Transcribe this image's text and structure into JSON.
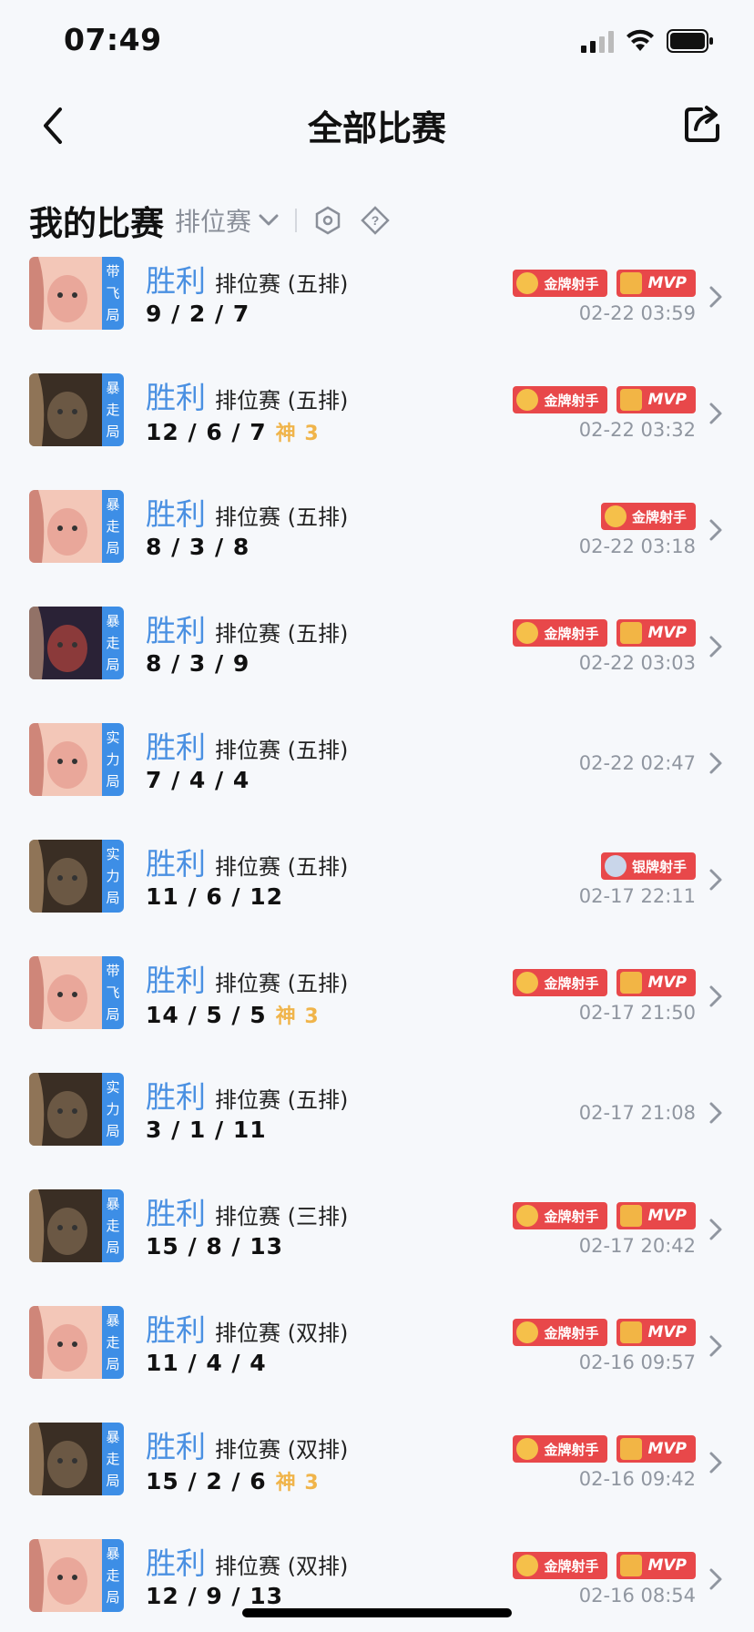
{
  "status_bar": {
    "time": "07:49"
  },
  "nav": {
    "title": "全部比赛"
  },
  "section": {
    "title": "我的比赛",
    "filter_label": "排位赛"
  },
  "colors": {
    "accent_blue": "#4a90e2",
    "tag_blue": "#3d8ee6",
    "badge_red": "#e8484a",
    "streak_gold": "#f0b44a"
  },
  "matches": [
    {
      "hero": "pink",
      "tag": "带飞局",
      "result": "胜利",
      "type": "排位赛 (五排)",
      "kda": "9 / 2 / 7",
      "streak": "",
      "badges": [
        "金牌射手",
        "MVP"
      ],
      "time": "02-22 03:59"
    },
    {
      "hero": "hat",
      "tag": "暴走局",
      "result": "胜利",
      "type": "排位赛 (五排)",
      "kda": "12 / 6 / 7",
      "streak": "神 3",
      "badges": [
        "金牌射手",
        "MVP"
      ],
      "time": "02-22 03:32"
    },
    {
      "hero": "pink",
      "tag": "暴走局",
      "result": "胜利",
      "type": "排位赛 (五排)",
      "kda": "8 / 3 / 8",
      "streak": "",
      "badges": [
        "金牌射手"
      ],
      "time": "02-22 03:18"
    },
    {
      "hero": "dark",
      "tag": "暴走局",
      "result": "胜利",
      "type": "排位赛 (五排)",
      "kda": "8 / 3 / 9",
      "streak": "",
      "badges": [
        "金牌射手",
        "MVP"
      ],
      "time": "02-22 03:03"
    },
    {
      "hero": "pink",
      "tag": "实力局",
      "result": "胜利",
      "type": "排位赛 (五排)",
      "kda": "7 / 4 / 4",
      "streak": "",
      "badges": [],
      "time": "02-22 02:47"
    },
    {
      "hero": "hat",
      "tag": "实力局",
      "result": "胜利",
      "type": "排位赛 (五排)",
      "kda": "11 / 6 / 12",
      "streak": "",
      "badges": [
        "银牌射手"
      ],
      "time": "02-17 22:11"
    },
    {
      "hero": "pink",
      "tag": "带飞局",
      "result": "胜利",
      "type": "排位赛 (五排)",
      "kda": "14 / 5 / 5",
      "streak": "神 3",
      "badges": [
        "金牌射手",
        "MVP"
      ],
      "time": "02-17 21:50"
    },
    {
      "hero": "hat",
      "tag": "实力局",
      "result": "胜利",
      "type": "排位赛 (五排)",
      "kda": "3 / 1 / 11",
      "streak": "",
      "badges": [],
      "time": "02-17 21:08"
    },
    {
      "hero": "hat",
      "tag": "暴走局",
      "result": "胜利",
      "type": "排位赛 (三排)",
      "kda": "15 / 8 / 13",
      "streak": "",
      "badges": [
        "金牌射手",
        "MVP"
      ],
      "time": "02-17 20:42"
    },
    {
      "hero": "pink",
      "tag": "暴走局",
      "result": "胜利",
      "type": "排位赛 (双排)",
      "kda": "11 / 4 / 4",
      "streak": "",
      "badges": [
        "金牌射手",
        "MVP"
      ],
      "time": "02-16 09:57"
    },
    {
      "hero": "hat",
      "tag": "暴走局",
      "result": "胜利",
      "type": "排位赛 (双排)",
      "kda": "15 / 2 / 6",
      "streak": "神 3",
      "badges": [
        "金牌射手",
        "MVP"
      ],
      "time": "02-16 09:42"
    },
    {
      "hero": "pink",
      "tag": "暴走局",
      "result": "胜利",
      "type": "排位赛 (双排)",
      "kda": "12 / 9 / 13",
      "streak": "",
      "badges": [
        "金牌射手",
        "MVP"
      ],
      "time": "02-16 08:54"
    }
  ]
}
